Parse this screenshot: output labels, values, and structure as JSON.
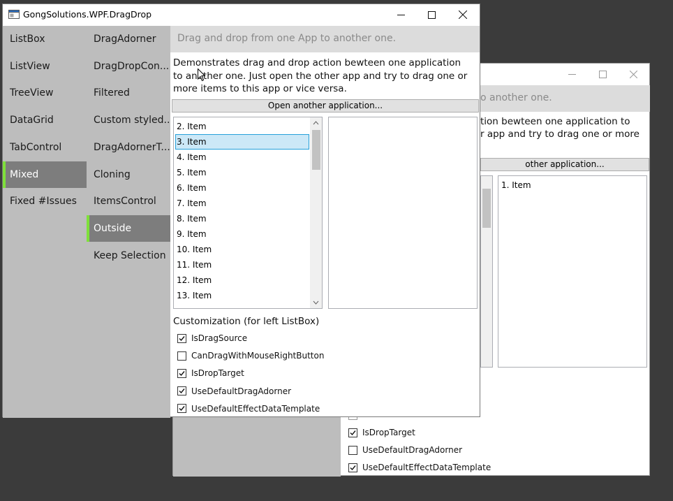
{
  "main_window": {
    "title": "GongSolutions.WPF.DragDrop",
    "nav_col1": [
      "ListBox",
      "ListView",
      "TreeView",
      "DataGrid",
      "TabControl",
      "Mixed",
      "Fixed #Issues"
    ],
    "nav_col1_selected": "Mixed",
    "nav_col2": [
      "DragAdorner",
      "DragDropCon...",
      "Filtered",
      "Custom styled...",
      "DragAdornerT...",
      "Cloning",
      "ItemsControl",
      "Outside",
      "Keep Selection"
    ],
    "nav_col2_selected": "Outside",
    "banner": "Drag and drop from one App to another one.",
    "description": "Demonstrates drag and drop action bewteen one application to another one. Just open the other app and try to drag one or more items to this app or vice versa.",
    "open_button": "Open another application...",
    "left_list": [
      "2. Item",
      "3. Item",
      "4. Item",
      "5. Item",
      "6. Item",
      "7. Item",
      "8. Item",
      "9. Item",
      "10. Item",
      "11. Item",
      "12. Item",
      "13. Item"
    ],
    "left_list_selected": "3. Item",
    "customization_title": "Customization (for left ListBox)",
    "options": [
      {
        "label": "IsDragSource",
        "checked": true
      },
      {
        "label": "CanDragWithMouseRightButton",
        "checked": false
      },
      {
        "label": "IsDropTarget",
        "checked": true
      },
      {
        "label": "UseDefaultDragAdorner",
        "checked": true
      },
      {
        "label": "UseDefaultEffectDataTemplate",
        "checked": true
      }
    ]
  },
  "back_window": {
    "banner": "o another one.",
    "description_line1": "tion bewteen one application to",
    "description_line2": "r app and try to drag one or more",
    "open_button": "other application...",
    "right_list": [
      "1. Item"
    ],
    "options": [
      {
        "label": "IsDropTarget",
        "checked": true
      },
      {
        "label": "UseDefaultDragAdorner",
        "checked": false
      },
      {
        "label": "UseDefaultEffectDataTemplate",
        "checked": true
      }
    ]
  },
  "colors": {
    "accent": "#7fe03a",
    "selection": "#cce8f7",
    "selection_border": "#26a0da"
  }
}
